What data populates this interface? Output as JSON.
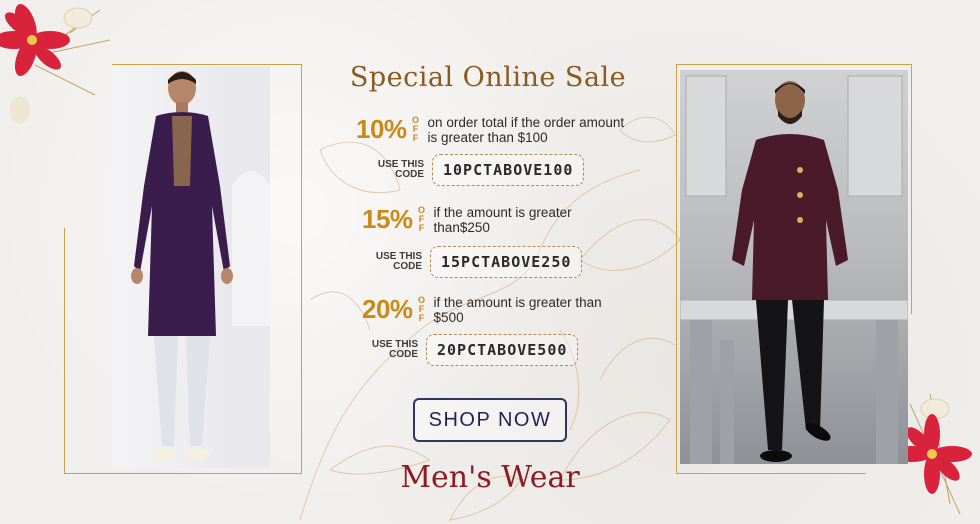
{
  "banner": {
    "title": "Special Online Sale",
    "off_text": [
      "O",
      "F",
      "F"
    ],
    "use_code_label": [
      "USE THIS",
      "CODE"
    ],
    "offers": [
      {
        "percent": "10%",
        "description": "on order total if the order amount is greater than $100",
        "code": "10PCTABOVE100"
      },
      {
        "percent": "15%",
        "description": "if the amount is greater than$250",
        "code": "15PCTABOVE250"
      },
      {
        "percent": "20%",
        "description": "if the amount is greater than $500",
        "code": "20PCTABOVE500"
      }
    ],
    "cta_label": "SHOP NOW",
    "subtitle": "Men's Wear"
  },
  "colors": {
    "gold": "#c98a18",
    "title_brown": "#8a5a1e",
    "subtitle_red": "#8c1c22",
    "button_navy": "#2e3560",
    "kurta_purple": "#3b1d4d",
    "jacket_wine": "#4a1a2a"
  },
  "icons": [
    "poinsettia-flower-icon",
    "leaf-branch-icon",
    "floral-line-art-icon"
  ]
}
